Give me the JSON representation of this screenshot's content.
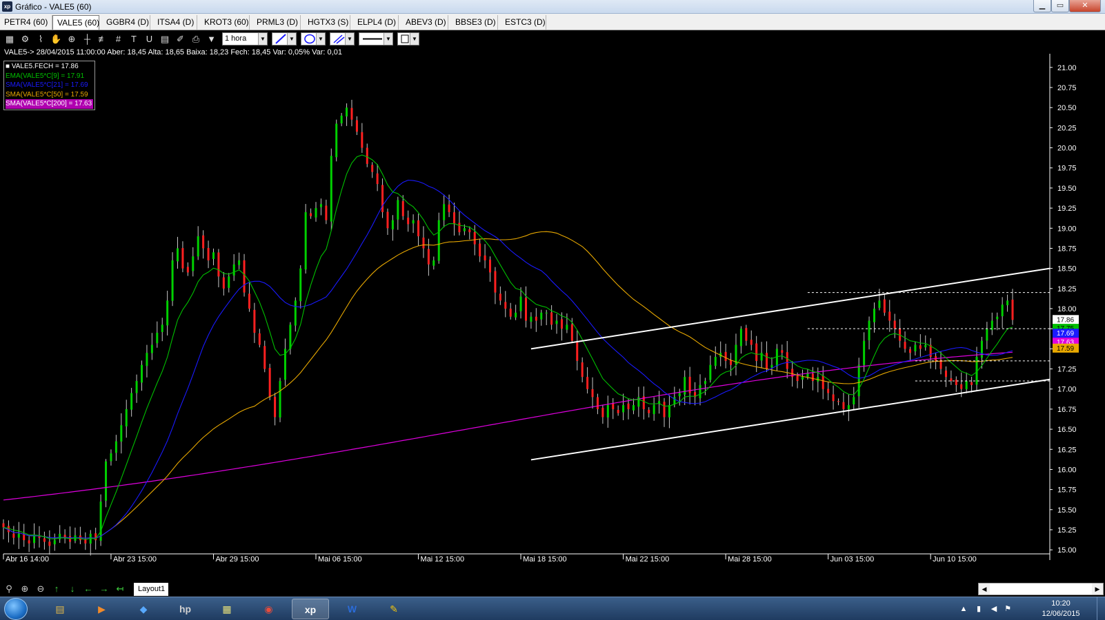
{
  "window": {
    "title": "Gráfico - VALE5 (60)",
    "app_icon": "xp",
    "buttons": {
      "minimize": "▁",
      "maximize": "▭",
      "close": "✕"
    }
  },
  "tabs": [
    {
      "label": "PETR4 (60)",
      "active": false
    },
    {
      "label": "VALE5 (60)",
      "active": true
    },
    {
      "label": "GGBR4 (D)",
      "active": false
    },
    {
      "label": "ITSA4 (D)",
      "active": false
    },
    {
      "label": "KROT3 (60)",
      "active": false
    },
    {
      "label": "PRML3 (D)",
      "active": false
    },
    {
      "label": "HGTX3 (S)",
      "active": false
    },
    {
      "label": "ELPL4 (D)",
      "active": false
    },
    {
      "label": "ABEV3 (D)",
      "active": false
    },
    {
      "label": "BBSE3 (D)",
      "active": false
    },
    {
      "label": "ESTC3 (D)",
      "active": false
    }
  ],
  "toolbar": {
    "icons": [
      "chart-type-icon",
      "gear-icon",
      "indicator-icon",
      "hand-icon",
      "zoom-icon",
      "crosshair-icon",
      "fibonacci-icon",
      "grid-icon",
      "text-icon",
      "magnet-icon",
      "calculator-icon",
      "pin-icon",
      "print-icon",
      "filter-icon"
    ],
    "period": "1 hora"
  },
  "info_line": "VALE5-> 28/04/2015 11:00:00 Aber: 18,45 Alta: 18,65 Baixa: 18,23 Fech: 18,45 Var: 0,05% Var: 0,01",
  "colors": {
    "up": "#00d000",
    "down": "#ff2020",
    "ema9": "#00c000",
    "sma21": "#1a1aff",
    "sma50": "#e8a800",
    "sma200": "#e000e0",
    "channel": "#ffffff",
    "axis": "#ffffff"
  },
  "chart_data": {
    "type": "candlestick",
    "series": [
      {
        "name": "VALE5.FECH = 17.86",
        "color": "#ffffff"
      },
      {
        "name": "EMA(VALE5*C[9] = 17.91",
        "color": "#00c000"
      },
      {
        "name": "SMA(VALE5*C[21] = 17.69",
        "color": "#1a1aff"
      },
      {
        "name": "SMA(VALE5*C[50] = 17.59",
        "color": "#e8a800"
      },
      {
        "name": "SMA(VALE5*C[200] = 17.63",
        "color": "#e000e0"
      }
    ],
    "y_ticks": [
      "21.00",
      "20.75",
      "20.50",
      "20.25",
      "20.00",
      "19.75",
      "19.50",
      "19.25",
      "19.00",
      "18.75",
      "18.50",
      "18.25",
      "18.00",
      "17.75",
      "17.50",
      "17.25",
      "17.00",
      "16.75",
      "16.50",
      "16.25",
      "16.00",
      "15.75",
      "15.50",
      "15.25",
      "15.00"
    ],
    "ylim": [
      14.95,
      21.05
    ],
    "x_ticks": [
      "Abr 16 14:00",
      "Abr 23 15:00",
      "Abr 29 15:00",
      "Mai 06 15:00",
      "Mai 12 15:00",
      "Mai 18 15:00",
      "Mai 22 15:00",
      "Mai 28 15:00",
      "Jun 03 15:00",
      "Jun 10 15:00"
    ],
    "n_bars": 200,
    "price_tags": [
      {
        "value": 17.86,
        "label": "17.86",
        "color": "#ffffff"
      },
      {
        "value": 17.75,
        "label": "17.75",
        "color": "#00c000"
      },
      {
        "value": 17.69,
        "label": "17.69",
        "color": "#1a1aff"
      },
      {
        "value": 17.63,
        "label": "17.63",
        "color": "#e000e0"
      },
      {
        "value": 17.59,
        "label": "17.59",
        "color": "#e8a800"
      }
    ],
    "close": [
      15.28,
      15.22,
      15.15,
      15.2,
      15.12,
      15.08,
      15.18,
      15.15,
      15.1,
      15.05,
      15.12,
      15.2,
      15.15,
      15.1,
      15.18,
      15.12,
      15.08,
      15.2,
      15.12,
      15.6,
      16.1,
      16.2,
      16.35,
      16.55,
      16.75,
      16.95,
      17.1,
      17.3,
      17.45,
      17.55,
      17.7,
      17.8,
      18.1,
      18.6,
      18.75,
      18.5,
      18.45,
      18.65,
      18.9,
      18.75,
      18.6,
      18.7,
      18.4,
      18.25,
      18.4,
      18.55,
      18.6,
      18.2,
      18.0,
      17.7,
      17.55,
      17.25,
      16.9,
      16.65,
      17.1,
      17.5,
      17.8,
      18.1,
      18.5,
      19.2,
      19.15,
      19.25,
      19.3,
      19.1,
      19.9,
      20.3,
      20.4,
      20.5,
      20.35,
      20.2,
      20.0,
      19.8,
      19.7,
      19.55,
      19.2,
      19.0,
      19.1,
      19.35,
      19.15,
      19.05,
      19.1,
      18.9,
      18.75,
      18.55,
      18.6,
      19.1,
      19.3,
      19.2,
      19.05,
      18.95,
      19.0,
      18.95,
      18.8,
      18.65,
      18.6,
      18.45,
      18.2,
      18.1,
      18.0,
      17.9,
      17.95,
      18.15,
      17.85,
      17.9,
      17.85,
      17.95,
      17.95,
      17.8,
      17.85,
      17.75,
      17.8,
      17.6,
      17.35,
      17.15,
      17.0,
      16.9,
      16.75,
      16.65,
      16.8,
      16.75,
      16.7,
      16.8,
      16.75,
      16.8,
      16.9,
      16.75,
      16.7,
      16.8,
      16.85,
      16.65,
      16.8,
      16.9,
      16.95,
      17.15,
      16.95,
      16.9,
      17.05,
      17.1,
      17.3,
      17.4,
      17.45,
      17.35,
      17.3,
      17.55,
      17.75,
      17.6,
      17.55,
      17.35,
      17.45,
      17.25,
      17.3,
      17.5,
      17.45,
      17.25,
      17.15,
      17.1,
      17.15,
      17.2,
      17.1,
      17.15,
      17.0,
      16.95,
      16.85,
      16.85,
      16.75,
      16.8,
      16.9,
      17.3,
      17.6,
      17.85,
      18.0,
      18.1,
      17.95,
      17.85,
      17.75,
      17.6,
      17.5,
      17.45,
      17.55,
      17.5,
      17.55,
      17.4,
      17.35,
      17.25,
      17.15,
      17.1,
      17.05,
      17.0,
      17.1,
      17.05,
      17.4,
      17.6,
      17.75,
      17.85,
      17.9,
      18.05,
      18.1,
      17.86
    ]
  },
  "bottom_bar": {
    "icons": [
      "zoom-fit-icon",
      "zoom-in-icon",
      "zoom-out-icon",
      "arrow-up-icon",
      "arrow-down-icon",
      "arrow-left-icon",
      "arrow-right-icon",
      "arrow-back-icon"
    ],
    "layout_tab": "Layout1"
  },
  "taskbar": {
    "items": [
      {
        "name": "explorer",
        "glyph": "▤"
      },
      {
        "name": "media-player",
        "glyph": "▶"
      },
      {
        "name": "network-app",
        "glyph": "◆"
      },
      {
        "name": "hp-app",
        "glyph": "hp"
      },
      {
        "name": "calculator-app",
        "glyph": "▦"
      },
      {
        "name": "chrome",
        "glyph": "◉"
      },
      {
        "name": "xp-trading",
        "glyph": "xp"
      },
      {
        "name": "word",
        "glyph": "W"
      },
      {
        "name": "paint",
        "glyph": "✎"
      }
    ],
    "time": "10:20",
    "date": "12/06/2015"
  }
}
